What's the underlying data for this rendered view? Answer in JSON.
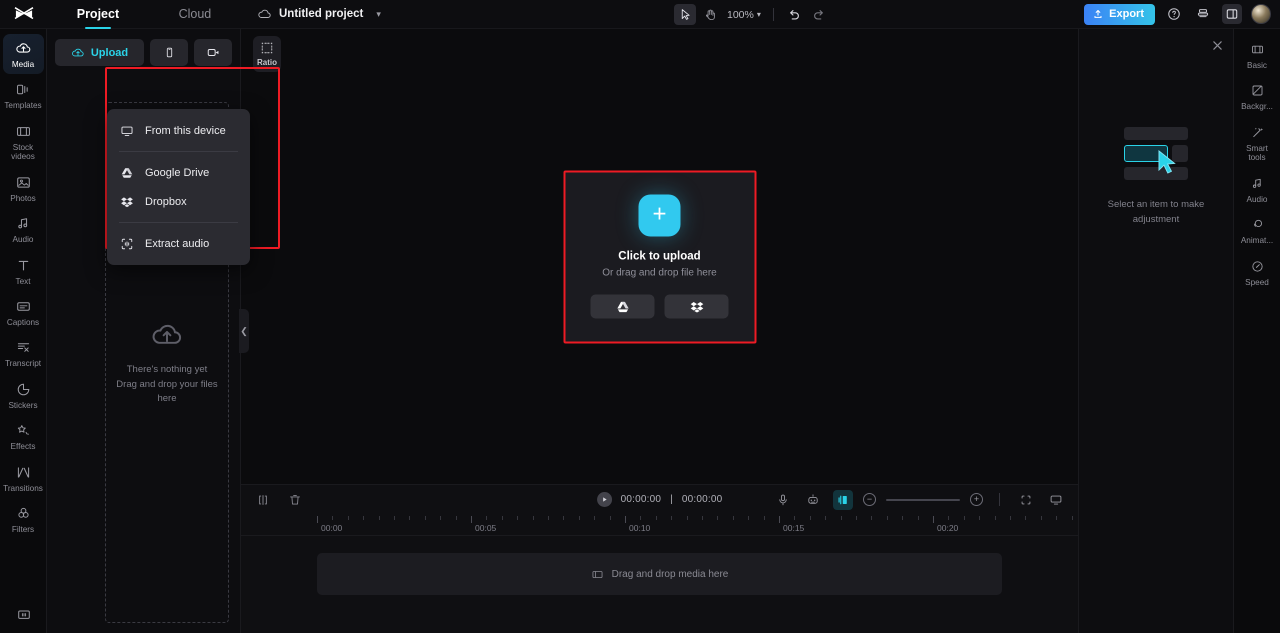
{
  "app": {
    "name": "CapCut",
    "logo_icon": "capcut-logo-icon"
  },
  "topbar": {
    "tabs": [
      {
        "label": "Project",
        "active": true
      },
      {
        "label": "Cloud",
        "active": false
      }
    ],
    "cloud_icon": "cloud-icon",
    "project_title": "Untitled project",
    "project_chevron": "chevron-down-icon",
    "tools": [
      {
        "name": "select-tool",
        "icon": "cursor-arrow-icon",
        "active": true
      },
      {
        "name": "hand-tool",
        "icon": "hand-icon",
        "active": false
      }
    ],
    "zoom_level": "100%",
    "zoom_chevron": "chevron-down-icon",
    "undo_icon": "undo-icon",
    "redo_icon": "redo-icon",
    "export_label": "Export",
    "export_icon": "export-upload-icon",
    "help_icon": "help-circle-icon",
    "save_icon": "save-icon",
    "layout_icon": "layout-panel-icon",
    "avatar": "user-avatar"
  },
  "left_rail": {
    "items": [
      {
        "label": "Media",
        "icon": "cloud-upload-icon",
        "active": true
      },
      {
        "label": "Templates",
        "icon": "templates-icon",
        "active": false
      },
      {
        "label": "Stock videos",
        "icon": "film-strip-icon",
        "active": false
      },
      {
        "label": "Photos",
        "icon": "photo-icon",
        "active": false
      },
      {
        "label": "Audio",
        "icon": "music-note-icon",
        "active": false
      },
      {
        "label": "Text",
        "icon": "text-t-icon",
        "active": false
      },
      {
        "label": "Captions",
        "icon": "captions-icon",
        "active": false
      },
      {
        "label": "Transcript",
        "icon": "transcript-icon",
        "active": false
      },
      {
        "label": "Stickers",
        "icon": "sticker-icon",
        "active": false
      },
      {
        "label": "Effects",
        "icon": "effects-sparkle-icon",
        "active": false
      },
      {
        "label": "Transitions",
        "icon": "transitions-icon",
        "active": false
      },
      {
        "label": "Filters",
        "icon": "filters-circles-icon",
        "active": false
      }
    ],
    "bottom_icon": "presentation-icon"
  },
  "media_panel": {
    "upload_label": "Upload",
    "upload_icon": "cloud-upload-icon",
    "phone_button_icon": "mobile-phone-icon",
    "record_button_icon": "video-camera-icon",
    "menu": {
      "items": [
        {
          "label": "From this device",
          "icon": "monitor-icon"
        },
        {
          "label": "Google Drive",
          "icon": "google-drive-icon"
        },
        {
          "label": "Dropbox",
          "icon": "dropbox-icon"
        },
        {
          "label": "Extract audio",
          "icon": "extract-audio-icon"
        }
      ]
    },
    "empty_icon": "cloud-upload-outline-icon",
    "empty_line1": "There's nothing yet",
    "empty_line2": "Drag and drop your files here",
    "collapse_icon": "chevron-left-icon"
  },
  "preview": {
    "ratio_label": "Ratio",
    "ratio_icon": "crop-frame-icon",
    "upload_card": {
      "plus_icon": "plus-icon",
      "title": "Click to upload",
      "subtitle": "Or drag and drop file here",
      "buttons": [
        {
          "icon": "google-drive-icon",
          "name": "google-drive-upload-button"
        },
        {
          "icon": "dropbox-icon",
          "name": "dropbox-upload-button"
        }
      ]
    }
  },
  "timeline": {
    "split_icon": "split-clip-icon",
    "delete_icon": "trash-icon",
    "play_icon": "play-icon",
    "current_time": "00:00:00",
    "time_separator": "|",
    "total_time": "00:00:00",
    "tools": [
      {
        "name": "voiceover-button",
        "icon": "microphone-icon",
        "active": false
      },
      {
        "name": "auto-captions-button",
        "icon": "robot-icon",
        "active": false
      },
      {
        "name": "audio-split-button",
        "icon": "audio-waveform-icon",
        "active": true
      }
    ],
    "zoom_out_icon": "minus-circle-icon",
    "zoom_in_icon": "plus-circle-icon",
    "fit_icon": "fit-to-screen-icon",
    "preview_icon": "monitor-preview-icon",
    "ruler_labels": [
      "00:00",
      "00:05",
      "00:10",
      "00:15",
      "00:20"
    ],
    "drop_track_label": "Drag and drop media here",
    "drop_track_icon": "media-clip-icon"
  },
  "right_panel": {
    "close_icon": "close-x-icon",
    "empty_message": "Select an item to make adjustment",
    "cursor_icon": "cursor-arrow-icon"
  },
  "right_rail": {
    "items": [
      {
        "label": "Basic",
        "icon": "basic-film-icon"
      },
      {
        "label": "Backgr...",
        "icon": "background-icon"
      },
      {
        "label": "Smart tools",
        "icon": "magic-wand-icon"
      },
      {
        "label": "Audio",
        "icon": "music-note-icon"
      },
      {
        "label": "Animat...",
        "icon": "animation-icon"
      },
      {
        "label": "Speed",
        "icon": "speed-gauge-icon"
      }
    ]
  },
  "colors": {
    "accent_cyan": "#2ad3e8",
    "export_blue": "#3b82f6",
    "annotation_red": "#ee1b24",
    "panel_bg": "#0d0d10"
  }
}
